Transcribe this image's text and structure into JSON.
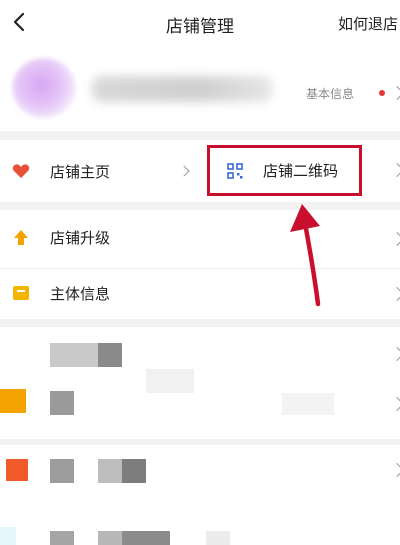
{
  "nav": {
    "title": "店铺管理",
    "right_link": "如何退店"
  },
  "profile": {
    "basic_info_label": "基本信息"
  },
  "rows": {
    "home": {
      "label": "店铺主页"
    },
    "qrcode": {
      "label": "店铺二维码"
    },
    "upgrade": {
      "label": "店铺升级"
    },
    "entity": {
      "label": "主体信息"
    }
  },
  "colors": {
    "highlight": "#c8102e",
    "arrow": "#c8102e",
    "heart": "#e8503a",
    "upgrade": "#f5a100",
    "entity": "#f5b400",
    "qr": "#3a6ad8"
  }
}
